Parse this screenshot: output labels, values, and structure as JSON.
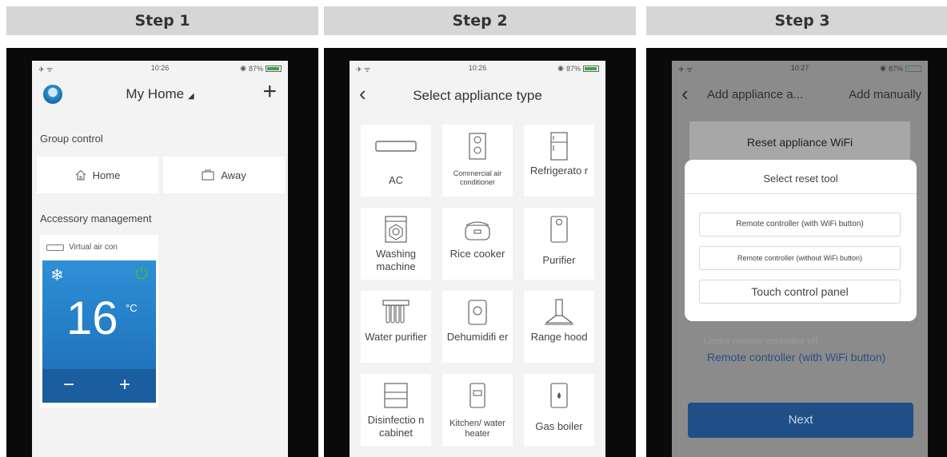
{
  "steps": [
    {
      "header": "Step 1"
    },
    {
      "header": "Step 2"
    },
    {
      "header": "Step 3"
    }
  ],
  "step1": {
    "status": {
      "time": "10:26",
      "battery": "87%"
    },
    "title": "My Home",
    "add_symbol": "+",
    "group_control_label": "Group control",
    "home_button": "Home",
    "away_button": "Away",
    "accessory_label": "Accessory management",
    "accessory": {
      "name": "Virtual air con",
      "temperature": "16",
      "unit": "°C",
      "minus": "−",
      "plus": "+"
    }
  },
  "step2": {
    "status": {
      "time": "10:26",
      "battery": "87%"
    },
    "title": "Select appliance type",
    "tiles": [
      {
        "label": "AC",
        "icon": "ac-unit-icon"
      },
      {
        "label": "Commercial air conditioner",
        "icon": "commercial-ac-icon"
      },
      {
        "label": "Refrigerato r",
        "icon": "refrigerator-icon"
      },
      {
        "label": "Washing machine",
        "icon": "washing-machine-icon"
      },
      {
        "label": "Rice cooker",
        "icon": "rice-cooker-icon"
      },
      {
        "label": "Purifier",
        "icon": "purifier-icon"
      },
      {
        "label": "Water purifier",
        "icon": "water-purifier-icon"
      },
      {
        "label": "Dehumidifi er",
        "icon": "dehumidifier-icon"
      },
      {
        "label": "Range hood",
        "icon": "range-hood-icon"
      },
      {
        "label": "Disinfectio n cabinet",
        "icon": "disinfection-cabinet-icon"
      },
      {
        "label": "Kitchen/ water heater",
        "icon": "water-heater-icon"
      },
      {
        "label": "Gas boiler",
        "icon": "gas-boiler-icon"
      }
    ]
  },
  "step3": {
    "status": {
      "time": "10:27",
      "battery": "87%"
    },
    "title": "Add appliance a...",
    "add_manually": "Add manually",
    "reset_wifi": "Reset appliance WiFi",
    "modal": {
      "title": "Select reset tool",
      "options": [
        "Remote controller (with WiFi button)",
        "Remote controller (without WiFi button)",
        "Touch control panel"
      ]
    },
    "faded_hint": "Under remote controller off",
    "remote_link": "Remote controller (with WiFi button)",
    "next_button": "Next"
  }
}
